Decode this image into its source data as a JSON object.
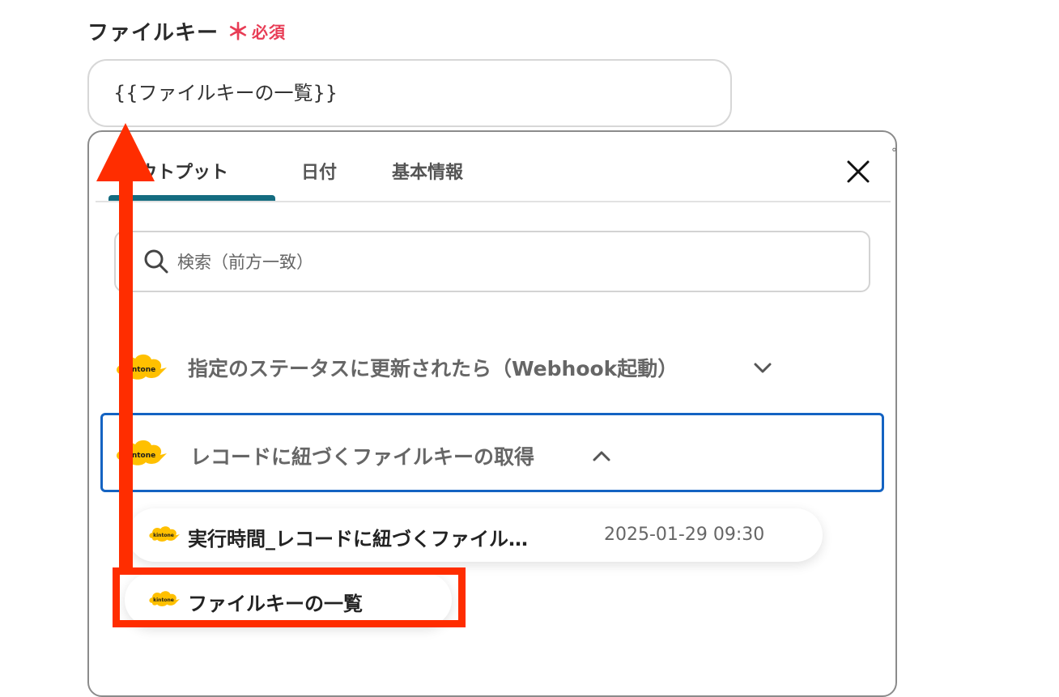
{
  "field": {
    "label": "ファイルキー",
    "required_mark": "＊",
    "required_text": "必須",
    "value": "{{ファイルキーの一覧}}"
  },
  "panel": {
    "tabs": [
      {
        "label": "アウトプット",
        "active": true
      },
      {
        "label": "日付",
        "active": false
      },
      {
        "label": "基本情報",
        "active": false
      }
    ],
    "search": {
      "placeholder": "検索（前方一致）"
    },
    "groups": [
      {
        "title": "指定のステータスに更新されたら（Webhook起動）",
        "expanded": false,
        "icon": "kintone-logo"
      },
      {
        "title": "レコードに紐づくファイルキーの取得",
        "expanded": true,
        "selected": true,
        "icon": "kintone-logo"
      }
    ],
    "outputs": [
      {
        "name": "実行時間_レコードに紐づくファイル…",
        "value": "2025-01-29 09:30"
      },
      {
        "name": "ファイルキーの一覧",
        "value": ""
      }
    ]
  },
  "logo_text": "kintone",
  "colors": {
    "required": "#e83c55",
    "tab_active": "#146c80",
    "selected_border": "#1463c2",
    "annotation": "#ff2d00",
    "kintone_yellow": "#ffc000"
  }
}
